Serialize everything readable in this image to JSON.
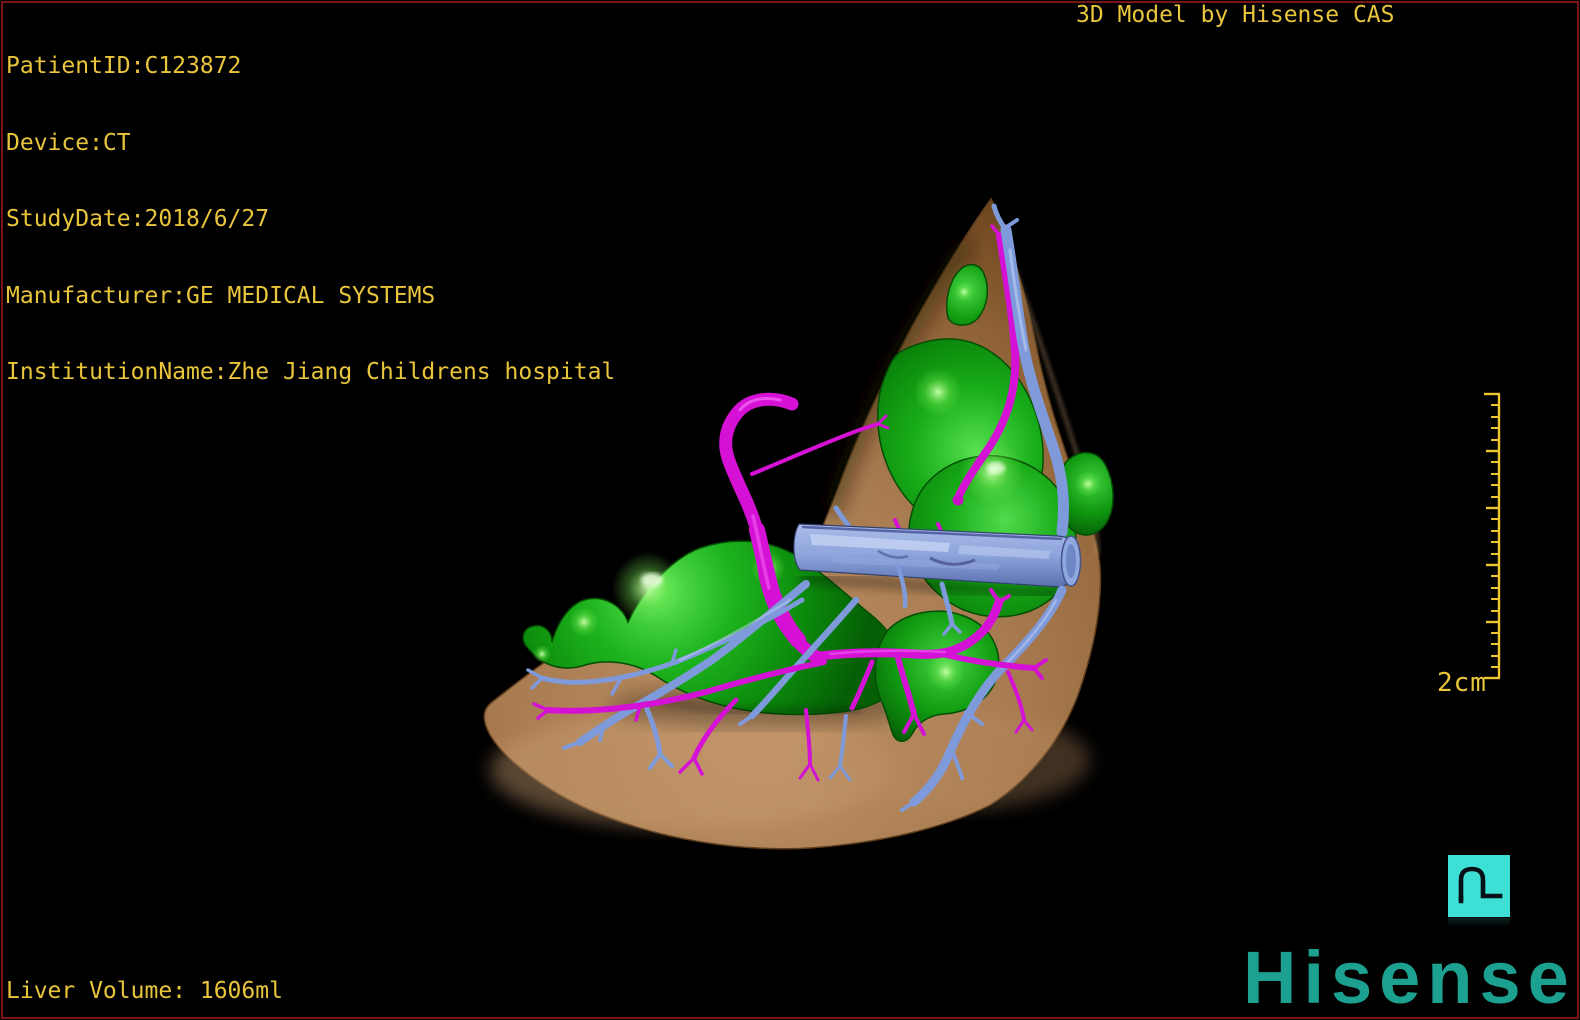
{
  "overlay": {
    "patient_lines": [
      "PatientID:C123872",
      "Device:CT",
      "StudyDate:2018/6/27",
      "Manufacturer:GE MEDICAL SYSTEMS",
      "InstitutionName:Zhe Jiang Childrens hospital"
    ],
    "title_right": "3D Model by Hisense CAS",
    "liver_volume": "Liver Volume: 1606ml",
    "scale_label": "2cm",
    "brand": "Hisense"
  },
  "colors": {
    "background": "#000000",
    "frame_border": "#7A1517",
    "overlay_text": "#E9C53B",
    "scalebar_yellow": "#EFC62F",
    "brand_teal": "#1CA190",
    "orientation_icon_cyan": "#3EE0D6",
    "liver_surface_tan": "#A87C50",
    "segment_green": "#0B8A0B",
    "portal_vein_magenta": "#D511D5",
    "hepatic_vein_blue": "#7E9ADB"
  },
  "model": {
    "organ": "liver",
    "structures": [
      {
        "name": "liver-surface",
        "color": "#A87C50"
      },
      {
        "name": "liver-segments",
        "color": "#0B8A0B"
      },
      {
        "name": "portal-vein-tree",
        "color": "#D511D5"
      },
      {
        "name": "hepatic-veins-ivc",
        "color": "#7E9ADB"
      }
    ]
  }
}
